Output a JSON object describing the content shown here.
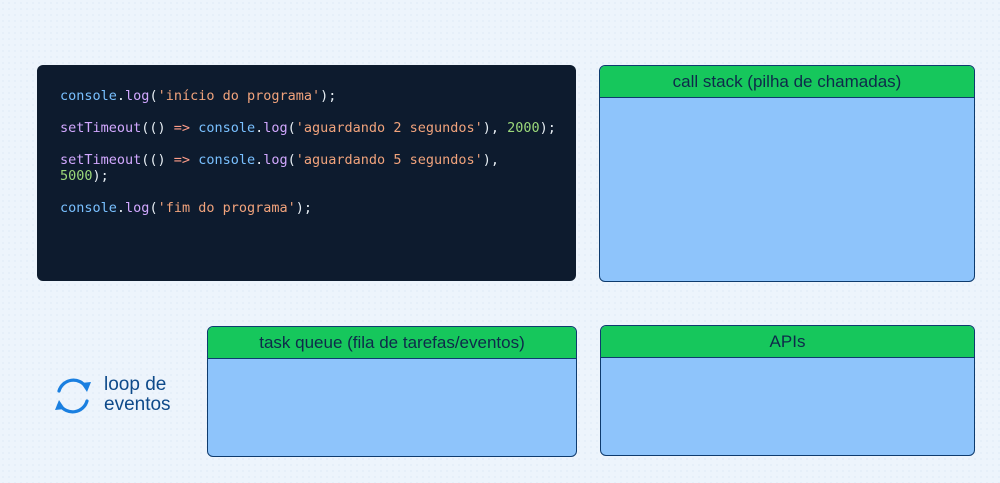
{
  "code": {
    "lines": [
      [
        {
          "t": "console",
          "c": "ident"
        },
        {
          "t": ".",
          "c": "punc"
        },
        {
          "t": "log",
          "c": "fn"
        },
        {
          "t": "(",
          "c": "punc"
        },
        {
          "t": "'início do programa'",
          "c": "str"
        },
        {
          "t": ");",
          "c": "punc"
        }
      ],
      [
        {
          "t": "setTimeout",
          "c": "fn"
        },
        {
          "t": "(() ",
          "c": "punc"
        },
        {
          "t": "=>",
          "c": "op"
        },
        {
          "t": " ",
          "c": "punc"
        },
        {
          "t": "console",
          "c": "ident"
        },
        {
          "t": ".",
          "c": "punc"
        },
        {
          "t": "log",
          "c": "fn"
        },
        {
          "t": "(",
          "c": "punc"
        },
        {
          "t": "'aguardando 2 segundos'",
          "c": "str"
        },
        {
          "t": "), ",
          "c": "punc"
        },
        {
          "t": "2000",
          "c": "num"
        },
        {
          "t": ");",
          "c": "punc"
        }
      ],
      [
        {
          "t": "setTimeout",
          "c": "fn"
        },
        {
          "t": "(() ",
          "c": "punc"
        },
        {
          "t": "=>",
          "c": "op"
        },
        {
          "t": " ",
          "c": "punc"
        },
        {
          "t": "console",
          "c": "ident"
        },
        {
          "t": ".",
          "c": "punc"
        },
        {
          "t": "log",
          "c": "fn"
        },
        {
          "t": "(",
          "c": "punc"
        },
        {
          "t": "'aguardando 5 segundos'",
          "c": "str"
        },
        {
          "t": "),",
          "c": "punc"
        }
      ],
      [
        {
          "t": "5000",
          "c": "num"
        },
        {
          "t": ");",
          "c": "punc"
        }
      ],
      [
        {
          "t": "console",
          "c": "ident"
        },
        {
          "t": ".",
          "c": "punc"
        },
        {
          "t": "log",
          "c": "fn"
        },
        {
          "t": "(",
          "c": "punc"
        },
        {
          "t": "'fim do programa'",
          "c": "str"
        },
        {
          "t": ");",
          "c": "punc"
        }
      ]
    ]
  },
  "call_stack": {
    "title": "call stack (pilha de chamadas)"
  },
  "task_queue": {
    "title": "task queue (fila de tarefas/eventos)"
  },
  "apis": {
    "title": "APIs"
  },
  "event_loop": {
    "line1": "loop de",
    "line2": "eventos",
    "icon": "refresh-icon"
  },
  "colors": {
    "header_green": "#16c75c",
    "box_blue": "#8ec4fb",
    "code_bg": "#0d1b2e",
    "loop_icon": "#1a7fe0"
  }
}
